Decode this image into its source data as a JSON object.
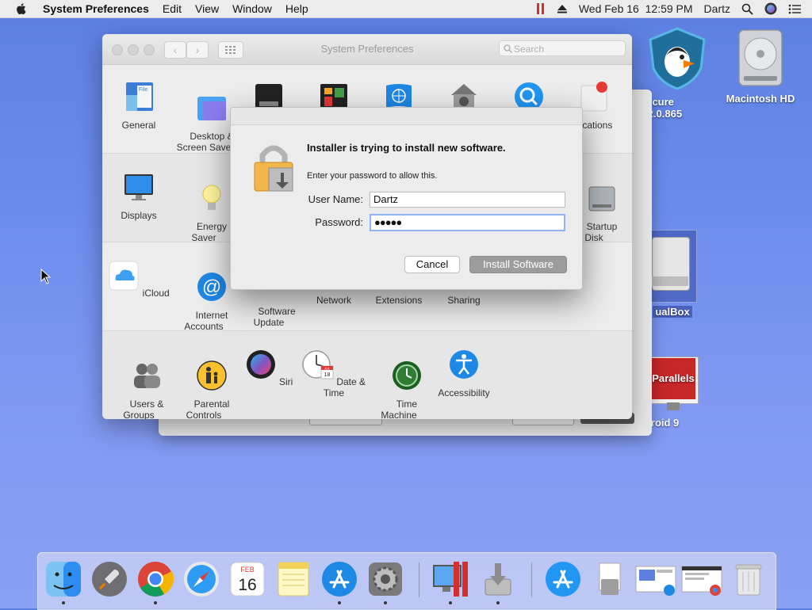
{
  "menubar": {
    "app_name": "System Preferences",
    "menus": [
      "Edit",
      "View",
      "Window",
      "Help"
    ],
    "clock": "Wed Feb 16  12:59 PM",
    "user": "Dartz"
  },
  "desktop": {
    "icons": [
      {
        "label": "n Secure\ne....2.0.865"
      },
      {
        "label": "Macintosh HD"
      },
      {
        "label": "ualBox"
      },
      {
        "label": "ndroid 9"
      }
    ]
  },
  "prefs_window": {
    "title": "System Preferences",
    "search_placeholder": "Search",
    "row1": [
      "General",
      "Desktop &\nScreen Save",
      "",
      "",
      "",
      "",
      "",
      "ifications"
    ],
    "row2": [
      "Displays",
      "Energy\nSaver",
      "Startup\nDisk"
    ],
    "row3": [
      "iCloud",
      "Internet\nAccounts",
      "Software\nUpdate",
      "Network",
      "Extensions",
      "Sharing"
    ],
    "row4": [
      "Users &\nGroups",
      "Parental\nControls",
      "Siri",
      "Date & Time",
      "Time\nMachine",
      "Accessibility"
    ]
  },
  "dialog": {
    "heading": "Installer is trying to install new software.",
    "subtext": "Enter your password to allow this.",
    "username_label": "User Name:",
    "username_value": "Dartz",
    "password_label": "Password:",
    "password_value": "●●●●●",
    "cancel_label": "Cancel",
    "install_label": "Install Software"
  },
  "calendar_icon": {
    "month": "FEB",
    "day": "16"
  },
  "date_time_icon": {
    "month": "JUL",
    "day": "18"
  },
  "parallels_label": "Parallels",
  "colors": {
    "desktop": "#6c8cec",
    "accent_blue": "#1e88e5",
    "install_button": "#9c9c9c"
  }
}
